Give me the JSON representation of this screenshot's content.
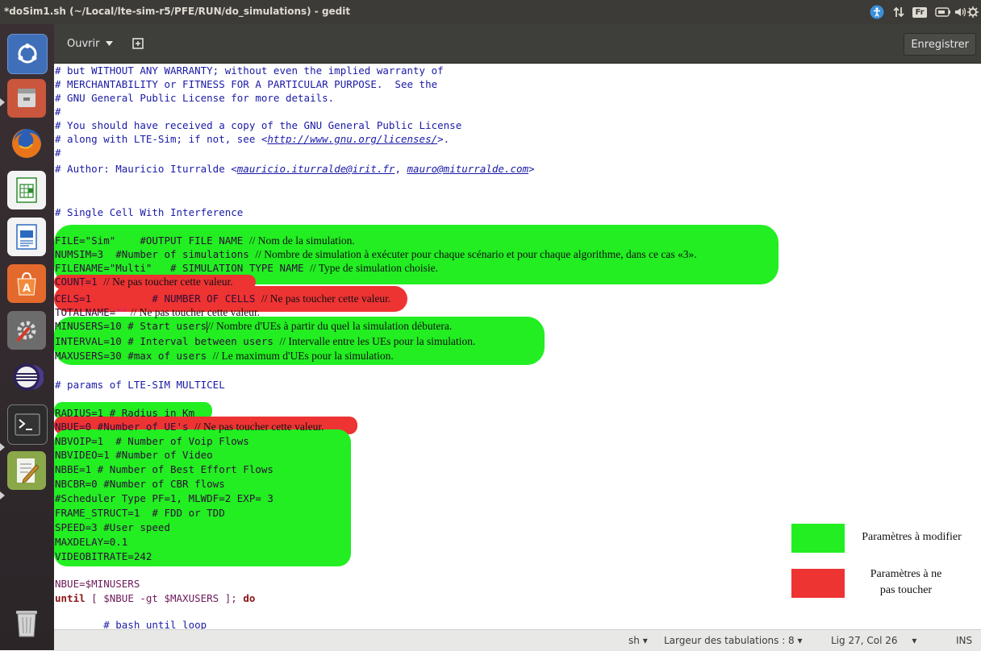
{
  "window": {
    "title": "*doSim1.sh (~/Local/lte-sim-r5/PFE/RUN/do_simulations) - gedit"
  },
  "tray": {
    "fr_label": "Fr"
  },
  "header": {
    "open_label": "Ouvrir",
    "save_label": "Enregistrer"
  },
  "launcher": {
    "items": [
      "ubuntu-logo-icon",
      "files-icon",
      "firefox-icon",
      "libreoffice-calc-icon",
      "libreoffice-writer-icon",
      "software-center-icon",
      "system-settings-icon",
      "eclipse-icon",
      "terminal-icon",
      "gedit-icon",
      "trash-icon"
    ]
  },
  "code": {
    "l1": "# but WITHOUT ANY WARRANTY; without even the implied warranty of",
    "l2": "# MERCHANTABILITY or FITNESS FOR A PARTICULAR PURPOSE.  See the",
    "l3": "# GNU General Public License for more details.",
    "l4": "#",
    "l5": "# You should have received a copy of the GNU General Public License",
    "l6a": "# along with LTE-Sim; if not, see <",
    "l6link": "http://www.gnu.org/licenses/",
    "l6b": ">.",
    "l7": "#",
    "l8a": "# Author: Mauricio Iturralde <",
    "l8link1": "mauricio.iturralde@irit.fr",
    "l8mid": ", ",
    "l8link2": "mauro@miturralde.com",
    "l8b": ">",
    "single_cell": "# Single Cell With Interference",
    "file_code": "FILE=\"Sim\"    #OUTPUT FILE NAME ",
    "file_note": "// Nom de la simulation.",
    "numsim_code": "NUMSIM=3  #Number of simulations ",
    "numsim_note": "// Nombre de simulation à exécuter pour chaque scénario et pour chaque algorithme, dans ce cas «3».",
    "filename_code": "FILENAME=\"Multi\"   # SIMULATION TYPE NAME ",
    "filename_note": "// Type de simulation choisie.",
    "count_code": "COUNT=1 ",
    "count_note": "// Ne pas toucher cette valeur.",
    "cels_code": "CELS=1          # NUMBER OF CELLS ",
    "cels_note": "// Ne pas toucher cette valeur.",
    "totalname_var": "TOTALNAME=",
    "totalname_str": "\"\"",
    "totalname_note": " // Ne pas toucher cette valeur.",
    "minusers_code": "MINUSERS=10 # Start users",
    "minusers_note": "// Nombre d'UEs à partir du quel la simulation débutera.",
    "interval_code": "INTERVAL=10 # Interval between users ",
    "interval_note": "// Intervalle entre les UEs pour la simulation.",
    "maxusers_code": "MAXUSERS=30 #max of users ",
    "maxusers_note": "// Le maximum d'UEs pour la simulation.",
    "params": "# params of LTE-SIM MULTICEL",
    "radius": "RADIUS=1 # Radius in Km",
    "nbue0_code": "NBUE=0 #Number of UE's ",
    "nbue0_note": "// Ne pas toucher cette valeur.",
    "nbvoip": "NBVOIP=1  # Number of Voip Flows",
    "nbvideo": "NBVIDEO=1 #Number of Video",
    "nbbe": "NBBE=1 # Number of Best Effort Flows",
    "nbcbr": "NBCBR=0 #Number of CBR flows",
    "scheduler": "#Scheduler Type PF=1, MLWDF=2 EXP= 3",
    "frame": "FRAME_STRUCT=1  # FDD or TDD",
    "speed": "SPEED=3 #User speed",
    "maxdelay": "MAXDELAY=0.1",
    "videobitrate": "VIDEOBITRATE=242",
    "nbue_min": "NBUE=$MINUSERS",
    "until_kw": "until",
    "until_rest": " [ $NBUE -gt $MAXUSERS ]; ",
    "do_kw": "do",
    "bash_comment": "        # bash until loop"
  },
  "legend": {
    "modify_label": "Paramètres à modifier",
    "keep_label_1": "Paramètres à ne",
    "keep_label_2": "pas toucher",
    "modify_color": "#22ee22",
    "keep_color": "#ee3333"
  },
  "status": {
    "language": "sh",
    "tab_width": "Largeur des tabulations : 8",
    "position": "Lig 27, Col 26",
    "mode": "INS"
  }
}
